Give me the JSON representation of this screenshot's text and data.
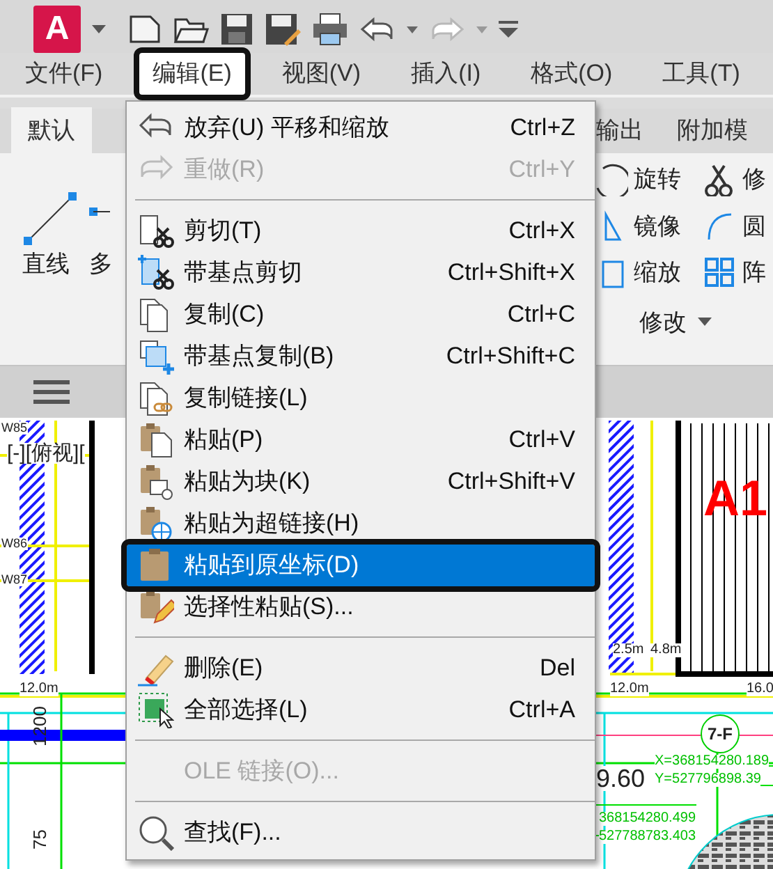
{
  "app_button": {
    "label": "A"
  },
  "menubar": [
    {
      "label": "文件(F)",
      "selected": false,
      "annotated": false
    },
    {
      "label": "编辑(E)",
      "selected": true,
      "annotated": true
    },
    {
      "label": "视图(V)",
      "selected": false,
      "annotated": false
    },
    {
      "label": "插入(I)",
      "selected": false,
      "annotated": false
    },
    {
      "label": "格式(O)",
      "selected": false,
      "annotated": false
    },
    {
      "label": "工具(T)",
      "selected": false,
      "annotated": false
    }
  ],
  "ribbon_tabs": [
    {
      "label": "默认",
      "selected": true
    },
    {
      "label": "输出",
      "selected": false
    },
    {
      "label": "附加模",
      "selected": false
    }
  ],
  "ribbon_left_tools": [
    "直线",
    "多"
  ],
  "ribbon_right_tools": [
    "旋转",
    "修",
    "镜像",
    "圆",
    "缩放",
    "阵"
  ],
  "ribbon_panel_label": "修改",
  "edit_menu": [
    {
      "kind": "item",
      "label": "放弃(U) 平移和缩放",
      "shortcut": "Ctrl+Z",
      "disabled": false,
      "selected": false,
      "annotated": false
    },
    {
      "kind": "item",
      "label": "重做(R)",
      "shortcut": "Ctrl+Y",
      "disabled": true,
      "selected": false,
      "annotated": false
    },
    {
      "kind": "separator"
    },
    {
      "kind": "item",
      "label": "剪切(T)",
      "shortcut": "Ctrl+X",
      "disabled": false,
      "selected": false,
      "annotated": false
    },
    {
      "kind": "item",
      "label": "带基点剪切",
      "shortcut": "Ctrl+Shift+X",
      "disabled": false,
      "selected": false,
      "annotated": false
    },
    {
      "kind": "item",
      "label": "复制(C)",
      "shortcut": "Ctrl+C",
      "disabled": false,
      "selected": false,
      "annotated": false
    },
    {
      "kind": "item",
      "label": "带基点复制(B)",
      "shortcut": "Ctrl+Shift+C",
      "disabled": false,
      "selected": false,
      "annotated": false
    },
    {
      "kind": "item",
      "label": "复制链接(L)",
      "disabled": false,
      "selected": false,
      "annotated": false
    },
    {
      "kind": "item",
      "label": "粘贴(P)",
      "shortcut": "Ctrl+V",
      "disabled": false,
      "selected": false,
      "annotated": false
    },
    {
      "kind": "item",
      "label": "粘贴为块(K)",
      "shortcut": "Ctrl+Shift+V",
      "disabled": false,
      "selected": false,
      "annotated": false
    },
    {
      "kind": "item",
      "label": "粘贴为超链接(H)",
      "disabled": false,
      "selected": false,
      "annotated": false
    },
    {
      "kind": "item",
      "label": "粘贴到原坐标(D)",
      "disabled": false,
      "selected": true,
      "annotated": true
    },
    {
      "kind": "item",
      "label": "选择性粘贴(S)...",
      "disabled": false,
      "selected": false,
      "annotated": false
    },
    {
      "kind": "separator"
    },
    {
      "kind": "item",
      "label": "删除(E)",
      "shortcut": "Del",
      "disabled": false,
      "selected": false,
      "annotated": false
    },
    {
      "kind": "item",
      "label": "全部选择(L)",
      "shortcut": "Ctrl+A",
      "disabled": false,
      "selected": false,
      "annotated": false
    },
    {
      "kind": "separator"
    },
    {
      "kind": "item",
      "label": "OLE 链接(O)...",
      "disabled": true,
      "selected": false,
      "annotated": false
    },
    {
      "kind": "separator"
    },
    {
      "kind": "item",
      "label": "查找(F)...",
      "disabled": false,
      "selected": false,
      "annotated": false
    }
  ],
  "drawing": {
    "viewport_label": "[-][俯视][",
    "labels": [
      {
        "text": "W85",
        "kind": "small"
      },
      {
        "text": "W86",
        "kind": "small"
      },
      {
        "text": "W87",
        "kind": "small"
      },
      {
        "text": "12.0m",
        "kind": "small"
      },
      {
        "text": "1200",
        "kind": "vertical"
      },
      {
        "text": "75",
        "kind": "vertical"
      },
      {
        "text": "A1",
        "kind": "red"
      },
      {
        "text": "2.5m",
        "kind": "small"
      },
      {
        "text": "4.8m",
        "kind": "small"
      },
      {
        "text": "12.0m",
        "kind": "small"
      },
      {
        "text": "16.0",
        "kind": "small"
      },
      {
        "text": "7-F",
        "kind": "circle"
      },
      {
        "text": "9.60",
        "kind": "plain"
      },
      {
        "text": "X=368154280.189",
        "kind": "green"
      },
      {
        "text": "Y=527796898.39",
        "kind": "green"
      },
      {
        "text": "368154280.499",
        "kind": "green"
      },
      {
        "text": "527788783.403",
        "kind": "green"
      }
    ]
  }
}
